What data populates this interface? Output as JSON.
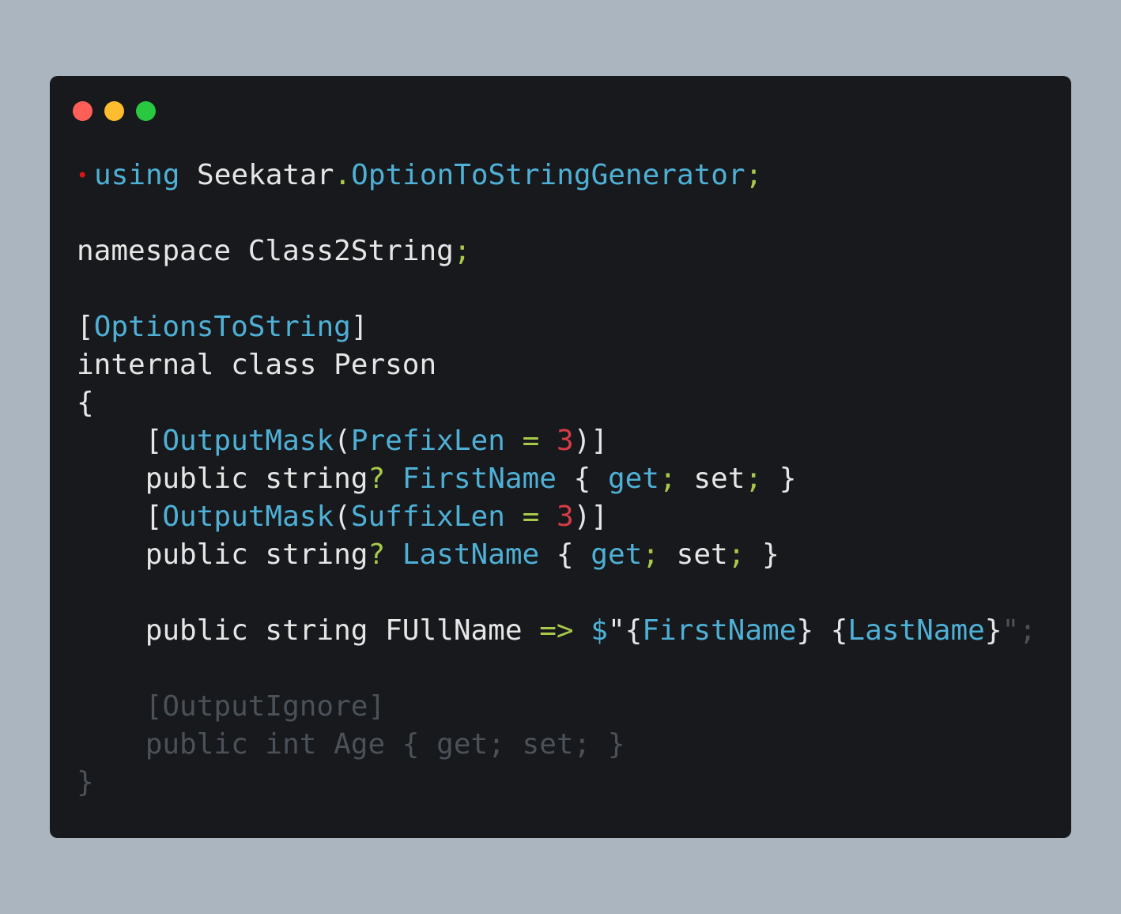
{
  "window": {
    "controls": [
      {
        "name": "close",
        "color": "#ff5f57"
      },
      {
        "name": "minimize",
        "color": "#febc2e"
      },
      {
        "name": "maximize",
        "color": "#28c840"
      }
    ],
    "marker": "•"
  },
  "colors": {
    "background": "#abb5bf",
    "editor": "#17191c",
    "keyword_text": "#e6e6e6",
    "type": "#4fb0d6",
    "punctuation": "#a8c94a",
    "number": "#d83c46",
    "dim": "#4a5158"
  },
  "code": {
    "lines": [
      [
        {
          "t": "using",
          "c": "cyan"
        },
        {
          "t": " Seekatar",
          "c": "plain"
        },
        {
          "t": ".",
          "c": "green"
        },
        {
          "t": "OptionToStringGenerator",
          "c": "cyan"
        },
        {
          "t": ";",
          "c": "green"
        }
      ],
      [],
      [
        {
          "t": "namespace Class2String",
          "c": "plain"
        },
        {
          "t": ";",
          "c": "green"
        }
      ],
      [],
      [
        {
          "t": "[",
          "c": "plain"
        },
        {
          "t": "OptionsToString",
          "c": "cyan"
        },
        {
          "t": "]",
          "c": "plain"
        }
      ],
      [
        {
          "t": "internal class Person",
          "c": "plain"
        }
      ],
      [
        {
          "t": "{",
          "c": "plain"
        }
      ],
      [
        {
          "t": "    [",
          "c": "plain"
        },
        {
          "t": "OutputMask",
          "c": "cyan"
        },
        {
          "t": "(",
          "c": "plain"
        },
        {
          "t": "PrefixLen",
          "c": "cyan"
        },
        {
          "t": " ",
          "c": "plain"
        },
        {
          "t": "=",
          "c": "green"
        },
        {
          "t": " ",
          "c": "plain"
        },
        {
          "t": "3",
          "c": "red"
        },
        {
          "t": ")]",
          "c": "plain"
        }
      ],
      [
        {
          "t": "    public string",
          "c": "plain"
        },
        {
          "t": "?",
          "c": "green"
        },
        {
          "t": " ",
          "c": "plain"
        },
        {
          "t": "FirstName",
          "c": "cyan"
        },
        {
          "t": " { ",
          "c": "plain"
        },
        {
          "t": "get",
          "c": "cyan"
        },
        {
          "t": ";",
          "c": "green"
        },
        {
          "t": " set",
          "c": "plain"
        },
        {
          "t": ";",
          "c": "green"
        },
        {
          "t": " }",
          "c": "plain"
        }
      ],
      [
        {
          "t": "    [",
          "c": "plain"
        },
        {
          "t": "OutputMask",
          "c": "cyan"
        },
        {
          "t": "(",
          "c": "plain"
        },
        {
          "t": "SuffixLen",
          "c": "cyan"
        },
        {
          "t": " ",
          "c": "plain"
        },
        {
          "t": "=",
          "c": "green"
        },
        {
          "t": " ",
          "c": "plain"
        },
        {
          "t": "3",
          "c": "red"
        },
        {
          "t": ")]",
          "c": "plain"
        }
      ],
      [
        {
          "t": "    public string",
          "c": "plain"
        },
        {
          "t": "?",
          "c": "green"
        },
        {
          "t": " ",
          "c": "plain"
        },
        {
          "t": "LastName",
          "c": "cyan"
        },
        {
          "t": " { ",
          "c": "plain"
        },
        {
          "t": "get",
          "c": "cyan"
        },
        {
          "t": ";",
          "c": "green"
        },
        {
          "t": " set",
          "c": "plain"
        },
        {
          "t": ";",
          "c": "green"
        },
        {
          "t": " }",
          "c": "plain"
        }
      ],
      [],
      [
        {
          "t": "    public string FUllName ",
          "c": "plain"
        },
        {
          "t": "=>",
          "c": "green"
        },
        {
          "t": " ",
          "c": "plain"
        },
        {
          "t": "$",
          "c": "cyan"
        },
        {
          "t": "\"{",
          "c": "plain"
        },
        {
          "t": "FirstName",
          "c": "cyan"
        },
        {
          "t": "} {",
          "c": "plain"
        },
        {
          "t": "LastName",
          "c": "cyan"
        },
        {
          "t": "}",
          "c": "plain"
        },
        {
          "t": "\";",
          "c": "dim"
        }
      ],
      [],
      [
        {
          "t": "    [OutputIgnore]",
          "c": "dim"
        }
      ],
      [
        {
          "t": "    public int Age { get; set; }",
          "c": "dim"
        }
      ],
      [
        {
          "t": "}",
          "c": "dim"
        }
      ]
    ]
  }
}
